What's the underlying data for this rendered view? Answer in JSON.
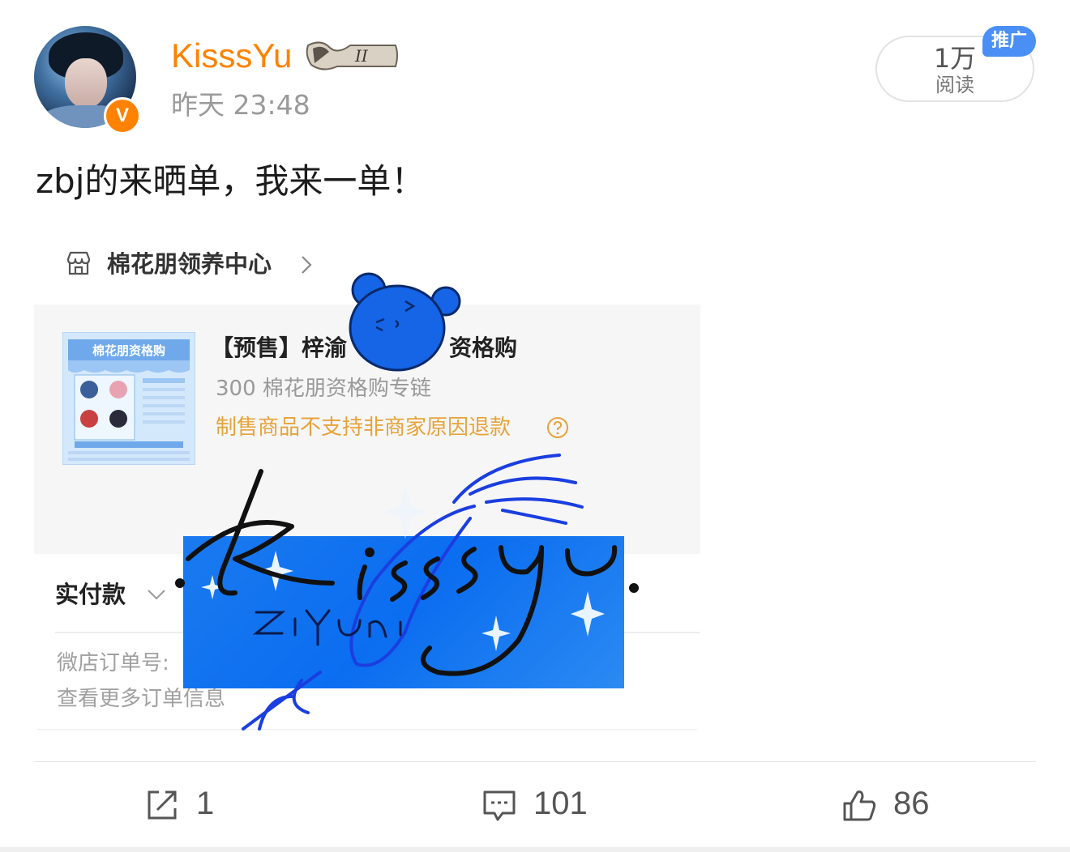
{
  "post": {
    "username": "KisssYu",
    "time": "昨天 23:48",
    "verified_badge": "V",
    "text": "zbj的来晒单，我来一单！",
    "reads": {
      "count": "1万",
      "label": "阅读"
    },
    "promo_label": "推广"
  },
  "screenshot": {
    "shop_name": "棉花朋领养中心",
    "product": {
      "title": "【预售】梓渝",
      "title_suffix": "资格购",
      "subtitle": "300 棉花朋资格购专链",
      "notice": "制售商品不支持非商家原因退款",
      "thumb_banner": "棉花朋资格购"
    },
    "paid_label": "实付款",
    "order_no_label": "微店订单号:",
    "more_order_info": "查看更多订单信息",
    "signature": "Kisssyu.",
    "signature_sub": "ZiYuni"
  },
  "actions": {
    "repost_count": "1",
    "comment_count": "101",
    "like_count": "86"
  },
  "colors": {
    "username": "#ff8200",
    "promo_badge": "#4a8ff5",
    "notice": "#e7a33a",
    "signature_box": "#0b6df0"
  },
  "icons": [
    "verified-v-icon",
    "store-icon",
    "chevron-right-icon",
    "help-circle-icon",
    "chevron-down-icon",
    "repost-icon",
    "comment-icon",
    "like-icon"
  ]
}
